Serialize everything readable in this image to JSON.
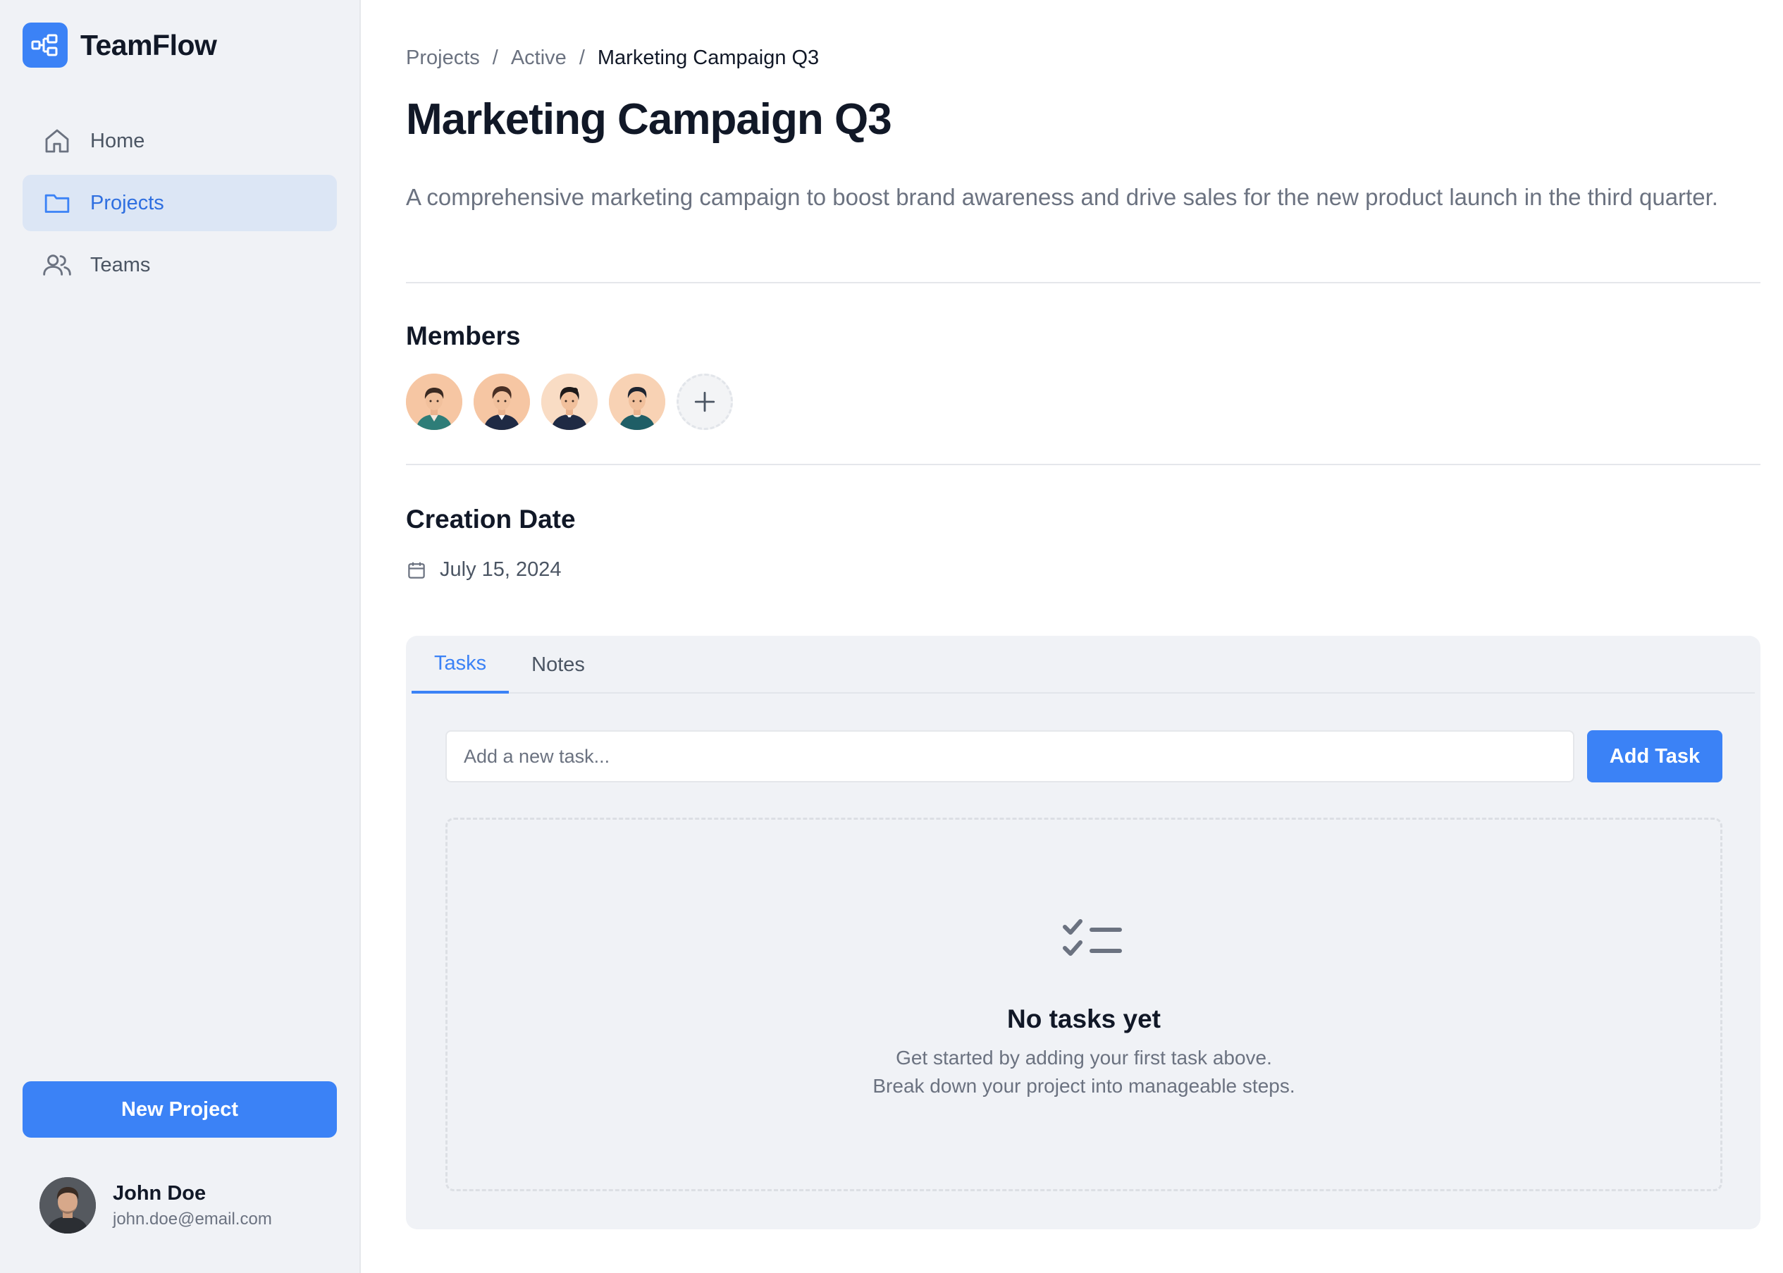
{
  "brand": {
    "name": "TeamFlow",
    "accent": "#3b82f6"
  },
  "sidebar": {
    "items": [
      {
        "label": "Home",
        "icon": "home-icon",
        "active": false
      },
      {
        "label": "Projects",
        "icon": "folder-icon",
        "active": true
      },
      {
        "label": "Teams",
        "icon": "users-icon",
        "active": false
      }
    ],
    "new_project_label": "New Project",
    "user": {
      "name": "John Doe",
      "email": "john.doe@email.com"
    }
  },
  "breadcrumb": [
    "Projects",
    "Active",
    "Marketing Campaign Q3"
  ],
  "breadcrumb_separator": "/",
  "project": {
    "title": "Marketing Campaign Q3",
    "description": "A comprehensive marketing campaign to boost brand awareness and drive sales for the new product launch in the third quarter.",
    "members_heading": "Members",
    "creation_heading": "Creation Date",
    "creation_date": "July 15, 2024"
  },
  "tabs": [
    {
      "label": "Tasks",
      "active": true
    },
    {
      "label": "Notes",
      "active": false
    }
  ],
  "tasks": {
    "input_placeholder": "Add a new task...",
    "input_value": "",
    "add_label": "Add Task",
    "empty_title": "No tasks yet",
    "empty_line1": "Get started by adding your first task above.",
    "empty_line2": "Break down your project into manageable steps."
  }
}
